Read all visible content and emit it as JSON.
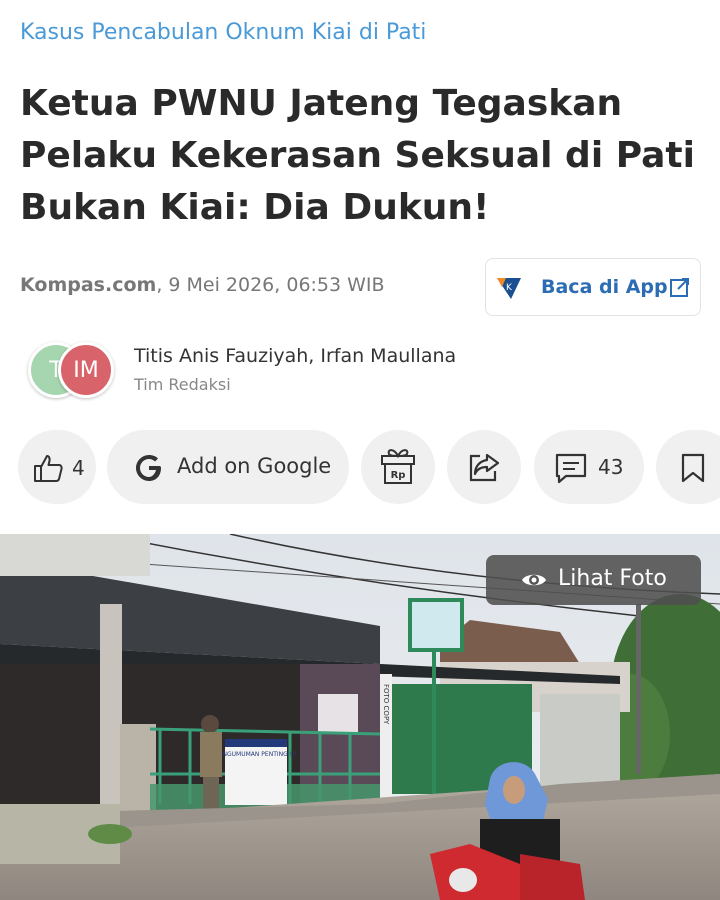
{
  "article": {
    "category": "Kasus Pencabulan Oknum Kiai di Pati",
    "headline_lines": [
      "Ketua PWNU Jateng Tegaskan",
      "Pelaku Kekerasan Seksual di Pati",
      "Bukan Kiai: Dia Dukun!"
    ],
    "source": "Kompas.com",
    "date": ", 9 Mei 2026, 06:53 WIB"
  },
  "app_button": {
    "label": "Baca di App",
    "icon": "external-link-icon",
    "logo": "kompas-app-logo"
  },
  "authors": {
    "avatars": [
      "T",
      "IM"
    ],
    "names": "Titis Anis Fauziyah,  Irfan Maullana",
    "team": "Tim Redaksi"
  },
  "actions": {
    "like_count": "4",
    "google_label": "Add on Google",
    "gift_text": "Rp",
    "comment_count": "43"
  },
  "photo": {
    "view_label": "Lihat Foto",
    "poster_text": "PENGUMUMAN PENTING !!!",
    "sign_text": "FOTO COPY"
  },
  "colors": {
    "category": "#4a9ad8",
    "app_label": "#2b6cb4",
    "pill_bg": "#f0f0f0"
  }
}
